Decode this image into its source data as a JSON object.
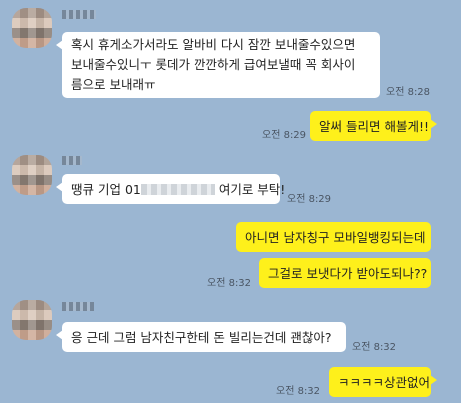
{
  "messages": [
    {
      "side": "in",
      "lines": [
        "혹시 휴게소가서라도 알바비 다시 잠깐 보내줄수있으면",
        "보내줄수있니ㅜ 롯데가 깐깐하게 급여보낼때 꼭 회사이",
        "름으로 보내래ㅠ"
      ],
      "time": "오전 8:28"
    },
    {
      "side": "out",
      "text": "알써 들리면 해볼게!!",
      "time": "오전 8:29"
    },
    {
      "side": "in",
      "text_before": "땡큐 기업 01",
      "text_after": " 여기로 부탁!",
      "time": "오전 8:29"
    },
    {
      "side": "out",
      "text": "아니면 남자칭구 모바일뱅킹되는데"
    },
    {
      "side": "out",
      "text": "그걸로 보냇다가 받아도되나??",
      "time": "오전 8:32"
    },
    {
      "side": "in",
      "text": "응 근데 그럼 남자친구한테 돈 빌리는건데 괜찮아?",
      "time": "오전 8:32"
    },
    {
      "side": "out",
      "text": "ㅋㅋㅋㅋ상관없어",
      "time": "오전 8:32"
    }
  ]
}
